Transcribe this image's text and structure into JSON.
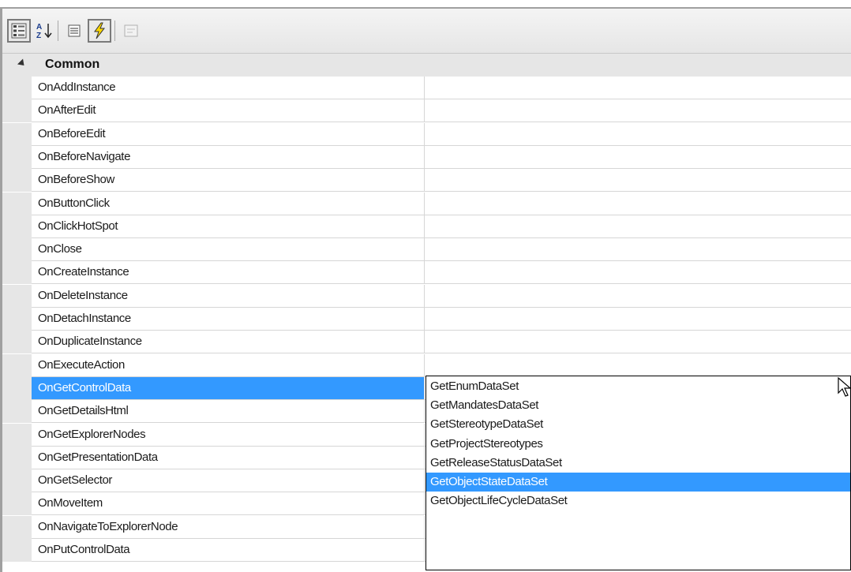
{
  "toolbar": {
    "buttons": [
      {
        "name": "categorized-view-button",
        "icon": "categorized-icon",
        "active": true
      },
      {
        "name": "alphabetical-sort-button",
        "icon": "alphabetical-sort-icon",
        "active": false
      },
      {
        "name": "properties-button",
        "icon": "properties-icon",
        "active": false
      },
      {
        "name": "events-button",
        "icon": "lightning-icon",
        "active": true
      },
      {
        "name": "property-pages-button",
        "icon": "property-pages-icon",
        "active": false
      }
    ]
  },
  "grid": {
    "category": "Common",
    "properties": [
      {
        "name": "OnAddInstance",
        "value": ""
      },
      {
        "name": "OnAfterEdit",
        "value": ""
      },
      {
        "name": "OnBeforeEdit",
        "value": ""
      },
      {
        "name": "OnBeforeNavigate",
        "value": ""
      },
      {
        "name": "OnBeforeShow",
        "value": ""
      },
      {
        "name": "OnButtonClick",
        "value": ""
      },
      {
        "name": "OnClickHotSpot",
        "value": ""
      },
      {
        "name": "OnClose",
        "value": ""
      },
      {
        "name": "OnCreateInstance",
        "value": ""
      },
      {
        "name": "OnDeleteInstance",
        "value": ""
      },
      {
        "name": "OnDetachInstance",
        "value": ""
      },
      {
        "name": "OnDuplicateInstance",
        "value": ""
      },
      {
        "name": "OnExecuteAction",
        "value": ""
      },
      {
        "name": "OnGetControlData",
        "value": "GetObjectStateDataSet"
      },
      {
        "name": "OnGetDetailsHtml",
        "value": ""
      },
      {
        "name": "OnGetExplorerNodes",
        "value": ""
      },
      {
        "name": "OnGetPresentationData",
        "value": ""
      },
      {
        "name": "OnGetSelector",
        "value": ""
      },
      {
        "name": "OnMoveItem",
        "value": ""
      },
      {
        "name": "OnNavigateToExplorerNode",
        "value": ""
      },
      {
        "name": "OnPutControlData",
        "value": ""
      }
    ]
  },
  "dropdown": {
    "options": [
      "GetEnumDataSet",
      "GetMandatesDataSet",
      "GetStereotypeDataSet",
      "GetProjectStereotypes",
      "GetReleaseStatusDataSet",
      "GetObjectStateDataSet",
      "GetObjectLifeCycleDataSet"
    ],
    "selected": "GetObjectStateDataSet"
  },
  "colors": {
    "selection": "#3399ff",
    "margin": "#e6e6e6",
    "gridline": "#d6d6d6"
  }
}
